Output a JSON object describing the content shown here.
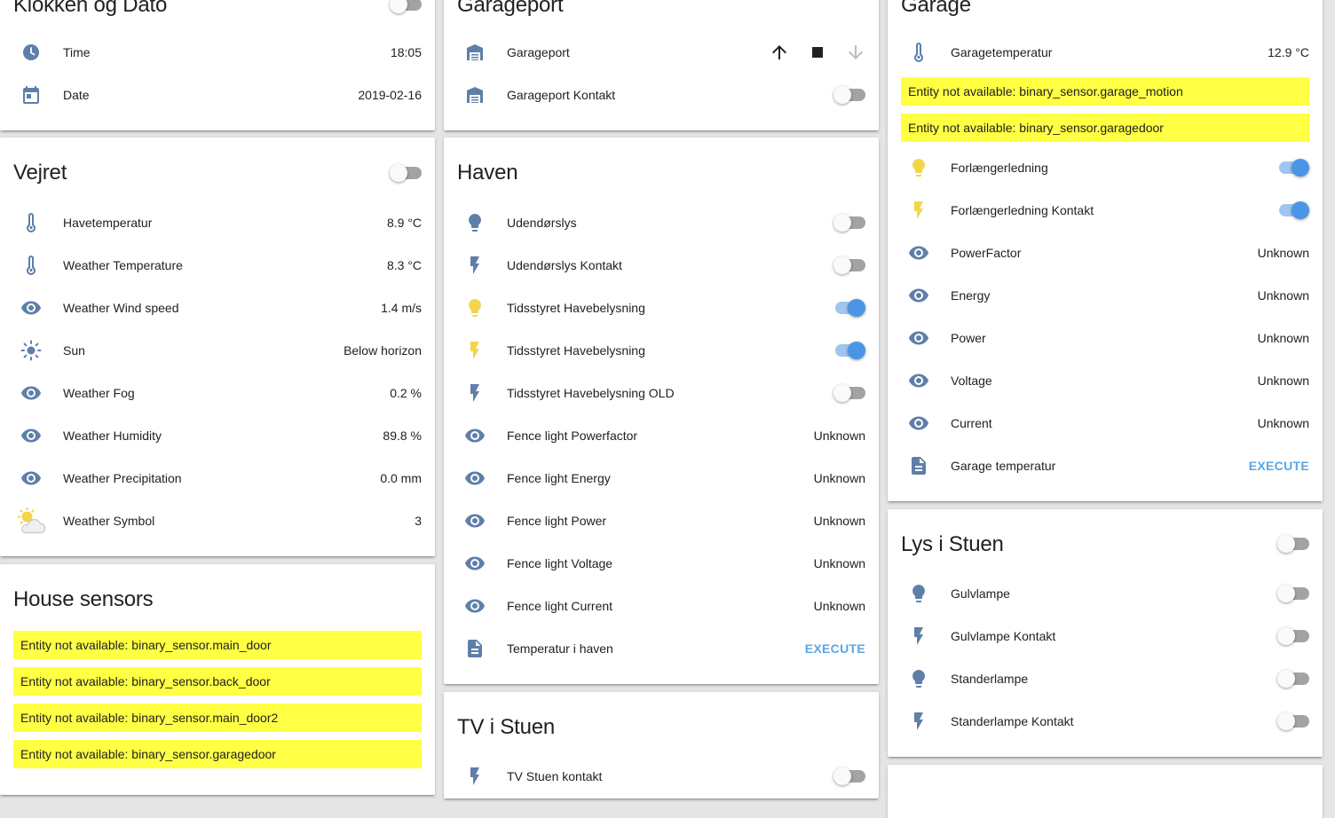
{
  "colors": {
    "icon": "#5e7fa8",
    "icon_active": "#f4d54a",
    "warning_bg": "#ffff44",
    "accent": "#4a95e6",
    "execute": "#58a6e8"
  },
  "klokken": {
    "title": "Klokken og Dato",
    "rows": [
      {
        "icon": "clock-icon",
        "label": "Time",
        "value": "18:05"
      },
      {
        "icon": "calendar-icon",
        "label": "Date",
        "value": "2019-02-16"
      }
    ]
  },
  "vejret": {
    "title": "Vejret",
    "rows": [
      {
        "icon": "thermometer-icon",
        "label": "Havetemperatur",
        "value": "8.9 °C"
      },
      {
        "icon": "thermometer-icon",
        "label": "Weather Temperature",
        "value": "8.3 °C"
      },
      {
        "icon": "eye-icon",
        "label": "Weather Wind speed",
        "value": "1.4 m/s"
      },
      {
        "icon": "sun-icon",
        "label": "Sun",
        "value": "Below horizon"
      },
      {
        "icon": "eye-icon",
        "label": "Weather Fog",
        "value": "0.2 %"
      },
      {
        "icon": "eye-icon",
        "label": "Weather Humidity",
        "value": "89.8 %"
      },
      {
        "icon": "eye-icon",
        "label": "Weather Precipitation",
        "value": "0.0 mm"
      },
      {
        "icon": "weather-symbol-icon",
        "label": "Weather Symbol",
        "value": "3"
      }
    ]
  },
  "house": {
    "title": "House sensors",
    "warnings": [
      "Entity not available: binary_sensor.main_door",
      "Entity not available: binary_sensor.back_door",
      "Entity not available: binary_sensor.main_door2",
      "Entity not available: binary_sensor.garagedoor"
    ]
  },
  "garageport": {
    "title": "Garageport",
    "rows": [
      {
        "icon": "garage-icon",
        "label": "Garageport"
      },
      {
        "icon": "garage-icon",
        "label": "Garageport Kontakt"
      }
    ]
  },
  "haven": {
    "title": "Haven",
    "rows": [
      {
        "icon": "bulb-icon",
        "label": "Udendørslys"
      },
      {
        "icon": "flash-icon",
        "label": "Udendørslys Kontakt"
      },
      {
        "icon": "bulb-icon",
        "label": "Tidsstyret Havebelysning"
      },
      {
        "icon": "flash-icon",
        "label": "Tidsstyret Havebelysning"
      },
      {
        "icon": "flash-icon",
        "label": "Tidsstyret Havebelysning OLD"
      },
      {
        "icon": "eye-icon",
        "label": "Fence light Powerfactor",
        "value": "Unknown"
      },
      {
        "icon": "eye-icon",
        "label": "Fence light Energy",
        "value": "Unknown"
      },
      {
        "icon": "eye-icon",
        "label": "Fence light Power",
        "value": "Unknown"
      },
      {
        "icon": "eye-icon",
        "label": "Fence light Voltage",
        "value": "Unknown"
      },
      {
        "icon": "eye-icon",
        "label": "Fence light Current",
        "value": "Unknown"
      },
      {
        "icon": "script-icon",
        "label": "Temperatur i haven",
        "action": "EXECUTE"
      }
    ]
  },
  "tv": {
    "title": "TV i Stuen",
    "rows": [
      {
        "icon": "flash-icon",
        "label": "TV Stuen kontakt"
      }
    ]
  },
  "garage": {
    "title": "Garage",
    "temp": {
      "icon": "thermometer-icon",
      "label": "Garagetemperatur",
      "value": "12.9 °C"
    },
    "warnings": [
      "Entity not available: binary_sensor.garage_motion",
      "Entity not available: binary_sensor.garagedoor"
    ],
    "rows": [
      {
        "icon": "bulb-icon",
        "label": "Forlængerledning"
      },
      {
        "icon": "flash-icon",
        "label": "Forlængerledning Kontakt"
      },
      {
        "icon": "eye-icon",
        "label": "PowerFactor",
        "value": "Unknown"
      },
      {
        "icon": "eye-icon",
        "label": "Energy",
        "value": "Unknown"
      },
      {
        "icon": "eye-icon",
        "label": "Power",
        "value": "Unknown"
      },
      {
        "icon": "eye-icon",
        "label": "Voltage",
        "value": "Unknown"
      },
      {
        "icon": "eye-icon",
        "label": "Current",
        "value": "Unknown"
      },
      {
        "icon": "script-icon",
        "label": "Garage temperatur",
        "action": "EXECUTE"
      }
    ]
  },
  "lys": {
    "title": "Lys i Stuen",
    "rows": [
      {
        "icon": "bulb-icon",
        "label": "Gulvlampe"
      },
      {
        "icon": "flash-icon",
        "label": "Gulvlampe Kontakt"
      },
      {
        "icon": "bulb-icon",
        "label": "Standerlampe"
      },
      {
        "icon": "flash-icon",
        "label": "Standerlampe Kontakt"
      }
    ]
  }
}
